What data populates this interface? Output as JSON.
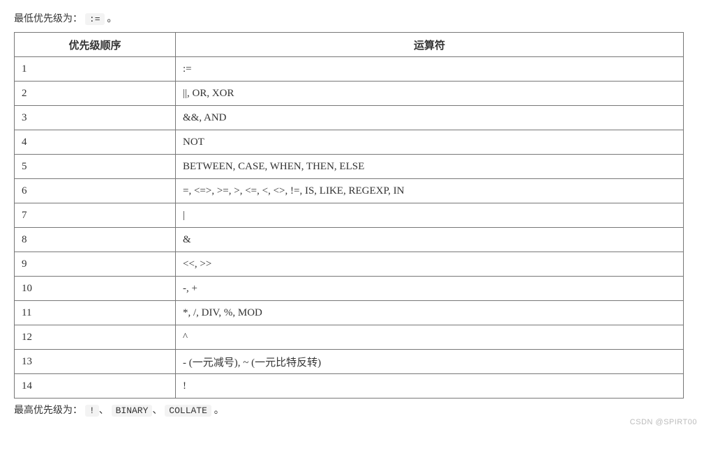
{
  "top_line": {
    "prefix": "最低优先级为：",
    "code": ":=",
    "suffix": "。"
  },
  "table": {
    "header": {
      "col1": "优先级顺序",
      "col2": "运算符"
    },
    "rows": [
      {
        "n": "1",
        "ops": ":="
      },
      {
        "n": "2",
        "ops": "||, OR, XOR"
      },
      {
        "n": "3",
        "ops": "&&, AND"
      },
      {
        "n": "4",
        "ops": "NOT"
      },
      {
        "n": "5",
        "ops": "BETWEEN, CASE, WHEN, THEN, ELSE"
      },
      {
        "n": "6",
        "ops": "=, <=>, >=, >, <=, <, <>, !=, IS, LIKE, REGEXP, IN"
      },
      {
        "n": "7",
        "ops": "|"
      },
      {
        "n": "8",
        "ops": "&"
      },
      {
        "n": "9",
        "ops": "<<, >>"
      },
      {
        "n": "10",
        "ops": "-, +"
      },
      {
        "n": "11",
        "ops": "*, /, DIV, %, MOD"
      },
      {
        "n": "12",
        "ops": "^"
      },
      {
        "n": "13",
        "ops": "- (一元减号), ~ (一元比特反转)"
      },
      {
        "n": "14",
        "ops": "!"
      }
    ]
  },
  "bottom_line": {
    "prefix": "最高优先级为：",
    "code1": "!",
    "sep1": "、",
    "code2": "BINARY",
    "sep2": "、",
    "code3": "COLLATE",
    "suffix": "。"
  },
  "credit": "CSDN @SPIRT00"
}
